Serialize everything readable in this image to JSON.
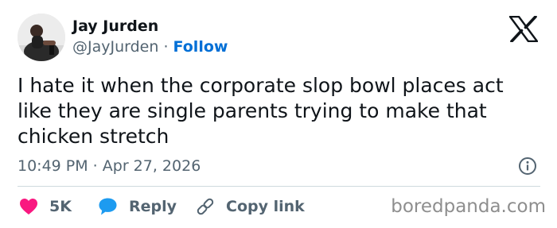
{
  "author": {
    "name": "Jay Jurden",
    "handle": "@JayJurden",
    "separator": "·",
    "follow_label": "Follow"
  },
  "tweet": {
    "text": "I hate it when the corporate slop bowl places act like they are single parents trying to make that chicken stretch",
    "timestamp": "10:49 PM · Apr 27, 2026"
  },
  "actions": {
    "likes_count": "5K",
    "reply_label": "Reply",
    "copy_link_label": "Copy link"
  },
  "watermark": "boredpanda.com",
  "icons": {
    "logo": "x-logo-icon",
    "info": "info-icon",
    "like": "heart-icon",
    "reply": "speech-bubble-icon",
    "copy": "link-icon"
  },
  "colors": {
    "like": "#f91880",
    "reply": "#1d9bf0",
    "follow": "#006fd6",
    "muted": "#536471",
    "text": "#0f1419"
  }
}
